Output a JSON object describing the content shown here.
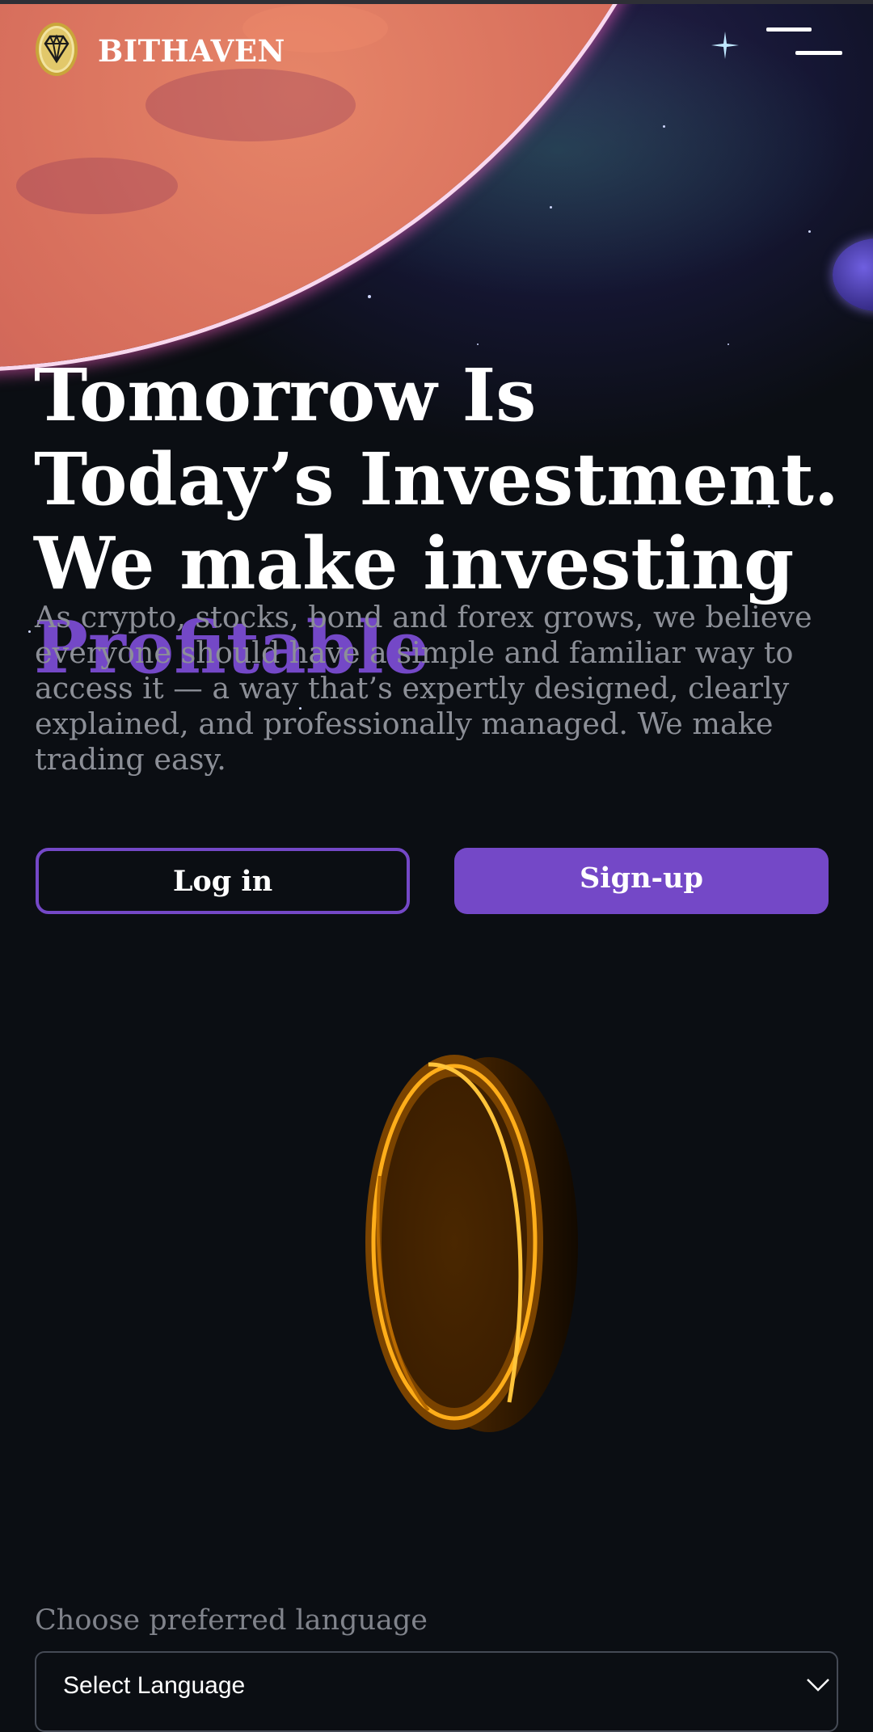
{
  "header": {
    "brand": "BITHAVEN",
    "logo_icon": "diamond-coin-icon",
    "menu_icon": "hamburger-menu-icon"
  },
  "hero": {
    "headline_part1": "Tomorrow Is Today’s Investment. We make investing ",
    "headline_accent": "Profitable",
    "subtext": "As crypto, stocks, bond and forex grows, we believe everyone should have a simple and familiar way to access it — a way that’s expertly designed, clearly explained, and professionally managed. We make trading easy."
  },
  "actions": {
    "login_label": "Log in",
    "signup_label": "Sign-up"
  },
  "illustration": {
    "icon": "gold-coin-icon"
  },
  "language": {
    "label": "Choose preferred language",
    "selected": "Select Language"
  },
  "colors": {
    "accent": "#7448c7",
    "background": "#0b0e13",
    "muted_text": "#8c8f97",
    "coin_gold": "#ff9d00"
  }
}
